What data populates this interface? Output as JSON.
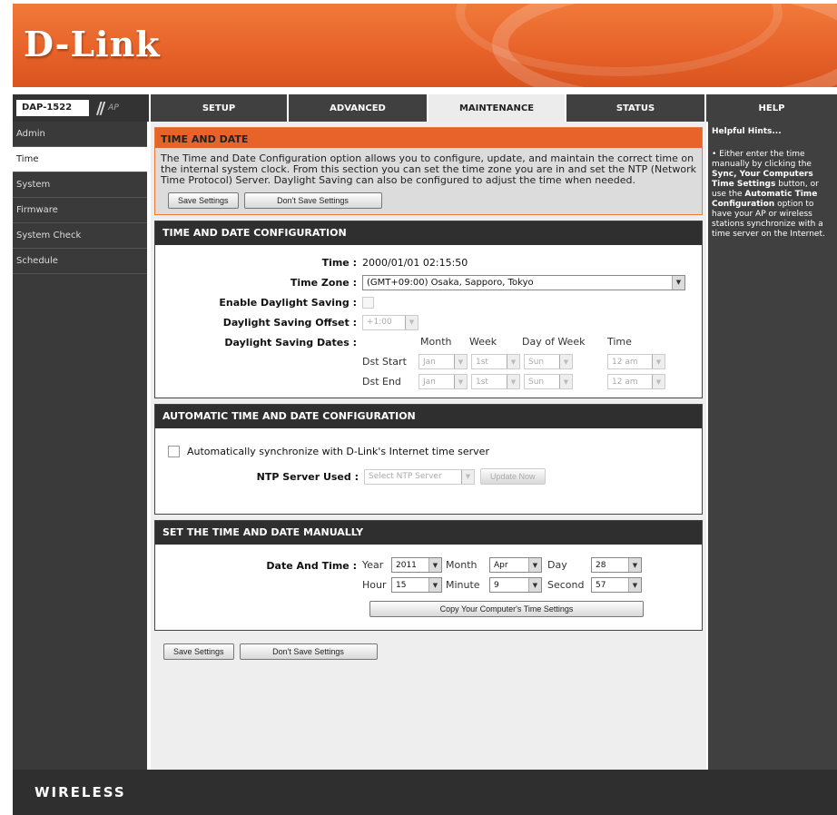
{
  "logo": "D-Link",
  "model": {
    "name": "DAP-1522",
    "slashes": "//",
    "mode": "AP"
  },
  "nav": {
    "tabs": [
      "SETUP",
      "ADVANCED",
      "MAINTENANCE",
      "STATUS",
      "HELP"
    ],
    "active": "MAINTENANCE"
  },
  "sidebar": {
    "items": [
      "Admin",
      "Time",
      "System",
      "Firmware",
      "System Check",
      "Schedule"
    ],
    "active": "Time"
  },
  "intro": {
    "title": "TIME AND DATE",
    "text": "The Time and Date Configuration option allows you to configure, update, and maintain the correct time on the internal system clock. From this section you can set the time zone you are in and set the NTP (Network Time Protocol) Server. Daylight Saving can also be configured to adjust the time when needed.",
    "save_label": "Save Settings",
    "dont_save_label": "Don't Save Settings"
  },
  "config": {
    "title": "TIME AND DATE CONFIGURATION",
    "time_label": "Time :",
    "time_value": "2000/01/01 02:15:50",
    "timezone_label": "Time Zone :",
    "timezone_value": "(GMT+09:00) Osaka, Sapporo, Tokyo",
    "enable_dst_label": "Enable Daylight Saving :",
    "dst_offset_label": "Daylight Saving Offset :",
    "dst_offset_value": "+1:00",
    "dst_dates_label": "Daylight Saving Dates :",
    "col_month": "Month",
    "col_week": "Week",
    "col_day": "Day of Week",
    "col_time": "Time",
    "dst_start": {
      "label": "Dst Start",
      "month": "Jan",
      "week": "1st",
      "day": "Sun",
      "time": "12 am"
    },
    "dst_end": {
      "label": "Dst End",
      "month": "Jan",
      "week": "1st",
      "day": "Sun",
      "time": "12 am"
    }
  },
  "auto": {
    "title": "AUTOMATIC TIME AND DATE CONFIGURATION",
    "sync_label": "Automatically synchronize with D-Link's Internet time server",
    "ntp_label": "NTP Server Used :",
    "ntp_value": "Select NTP Server",
    "update_label": "Update Now"
  },
  "manual": {
    "title": "SET THE TIME AND DATE MANUALLY",
    "dt_label": "Date And Time :",
    "year_label": "Year",
    "year_value": "2011",
    "month_label": "Month",
    "month_value": "Apr",
    "day_label": "Day",
    "day_value": "28",
    "hour_label": "Hour",
    "hour_value": "15",
    "minute_label": "Minute",
    "minute_value": "9",
    "second_label": "Second",
    "second_value": "57",
    "copy_label": "Copy Your Computer's Time Settings"
  },
  "bottom": {
    "save_label": "Save Settings",
    "dont_save_label": "Don't Save Settings"
  },
  "help": {
    "heading": "Helpful Hints...",
    "bullet": "•",
    "t1": " Either enter the time manually by clicking the ",
    "b1": "Sync, Your Computers Time Settings",
    "t2": " button, or use the ",
    "b2": "Automatic Time Configuration",
    "t3": " option to have your AP or wireless stations synchronize with a time server on the Internet."
  },
  "footer": {
    "brand": "WIRELESS"
  },
  "colors": {
    "orange": "#e8632a",
    "dark": "#2f2f2f",
    "panel": "#eeeeee"
  }
}
